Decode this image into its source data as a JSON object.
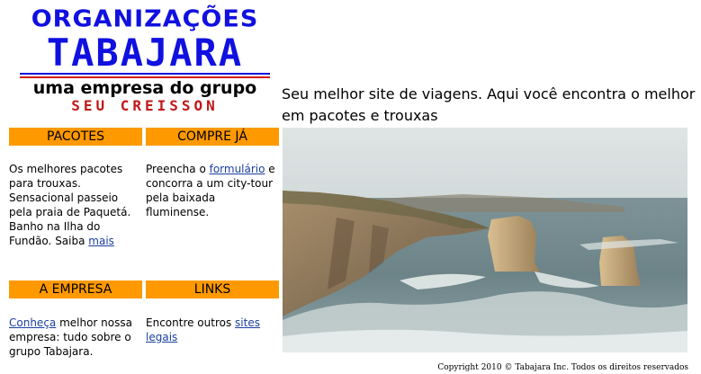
{
  "logo": {
    "line1": "ORGANIZAÇÕES",
    "line2": "TABAJARA",
    "line3": "uma empresa do grupo",
    "line4": "SEU CREISSON"
  },
  "pacotes": {
    "title": "PACOTES",
    "text": "Os melhores pacotes para trouxas. Sensacional passeio pela praia de Paquetá. Banho na Ilha do Fundão. Saiba ",
    "link": "mais"
  },
  "compre": {
    "title": "COMPRE JÁ",
    "text_before": "Preencha o ",
    "link": "formulário",
    "text_after": " e concorra a um city-tour pela baixada fluminense."
  },
  "empresa": {
    "title": "A EMPRESA",
    "link": "Conheça",
    "text": " melhor nossa empresa: tudo sobre o grupo Tabajara."
  },
  "links": {
    "title": "LINKS",
    "text": "Encontre outros ",
    "link": "sites legais"
  },
  "headline": "Seu melhor site de viagens. Aqui você encontra o melhor em pacotes e trouxas",
  "copyright": "Copyright 2010 © Tabajara Inc. Todos os direitos reservados",
  "colors": {
    "header_orange": "#ff9900",
    "logo_blue": "#1010e0",
    "logo_red": "#c01818",
    "link": "#1a3fa0"
  }
}
